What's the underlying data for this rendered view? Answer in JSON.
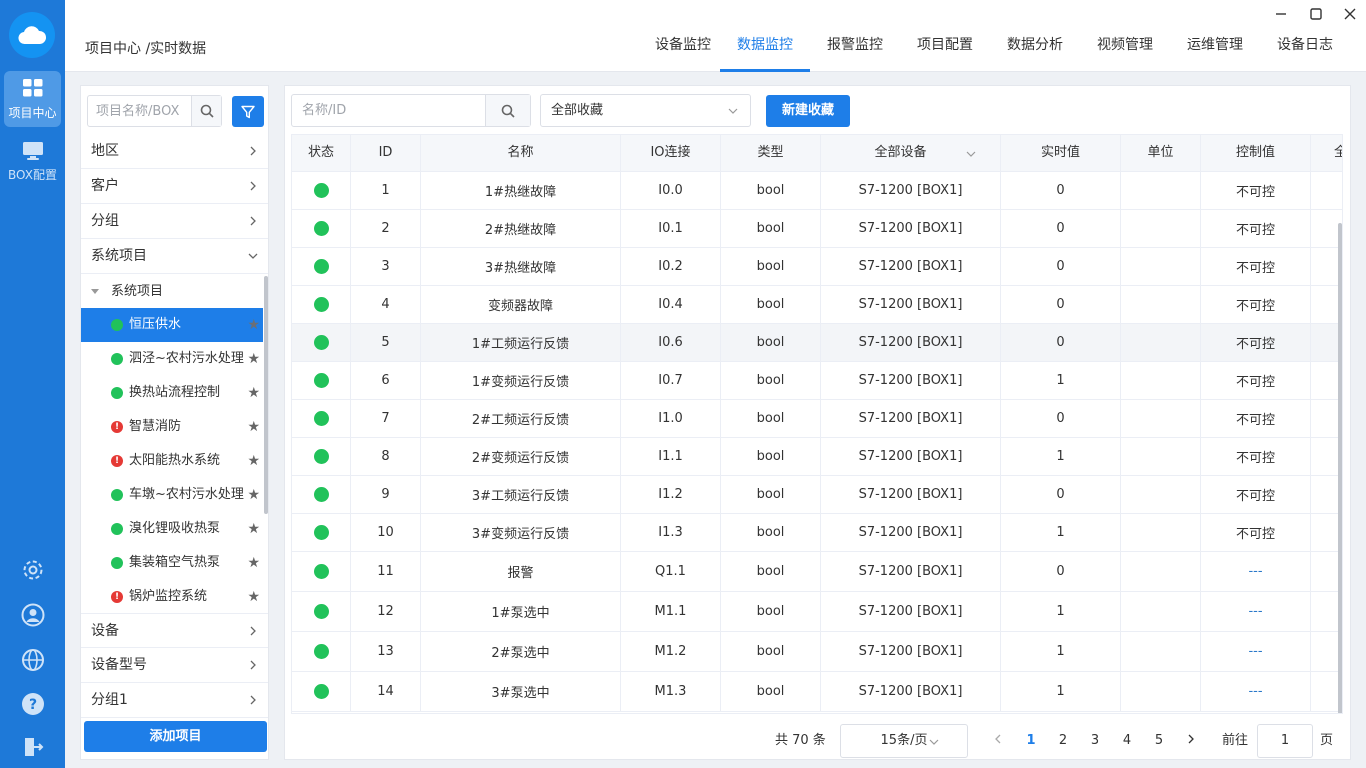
{
  "rail": {
    "items": [
      {
        "label": "项目中心",
        "icon": "grid-icon"
      },
      {
        "label": "BOX配置",
        "icon": "monitor-icon"
      }
    ],
    "bottom_icons": [
      "settings-gear-icon",
      "user-icon",
      "globe-icon",
      "help-icon",
      "logout-icon"
    ]
  },
  "header": {
    "breadcrumb": "项目中心 /实时数据",
    "tabs": [
      {
        "label": "设备监控"
      },
      {
        "label": "数据监控",
        "active": true
      },
      {
        "label": "报警监控"
      },
      {
        "label": "项目配置"
      },
      {
        "label": "数据分析"
      },
      {
        "label": "视频管理"
      },
      {
        "label": "运维管理"
      },
      {
        "label": "设备日志"
      }
    ]
  },
  "sidebar": {
    "search_placeholder": "项目名称/BOX",
    "categories_top": [
      {
        "label": "地区"
      },
      {
        "label": "客户"
      },
      {
        "label": "分组"
      },
      {
        "label": "系统项目"
      }
    ],
    "sub_header": "系统项目",
    "projects": [
      {
        "label": "恒压供水",
        "status": "ok",
        "active": true
      },
      {
        "label": "泗泾~农村污水处理",
        "status": "ok"
      },
      {
        "label": "换热站流程控制",
        "status": "ok"
      },
      {
        "label": "智慧消防",
        "status": "alarm"
      },
      {
        "label": "太阳能热水系统",
        "status": "alarm"
      },
      {
        "label": "车墩~农村污水处理",
        "status": "ok"
      },
      {
        "label": "溴化锂吸收热泵",
        "status": "ok"
      },
      {
        "label": "集装箱空气热泵",
        "status": "ok"
      },
      {
        "label": "锅炉监控系统",
        "status": "alarm"
      }
    ],
    "categories_bottom": [
      {
        "label": "设备"
      },
      {
        "label": "设备型号"
      },
      {
        "label": "分组1"
      }
    ],
    "add_label": "添加项目"
  },
  "toolbar": {
    "search_placeholder": "名称/ID",
    "favorites_selected": "全部收藏",
    "new_fav_label": "新建收藏"
  },
  "table": {
    "columns": [
      "状态",
      "ID",
      "名称",
      "IO连接",
      "类型",
      "全部设备",
      "实时值",
      "单位",
      "控制值",
      "全"
    ],
    "rows": [
      {
        "id": "1",
        "name": "1#热继故障",
        "io": "I0.0",
        "type": "bool",
        "device": "S7-1200 [BOX1]",
        "value": "0",
        "unit": "",
        "control": "不可控"
      },
      {
        "id": "2",
        "name": "2#热继故障",
        "io": "I0.1",
        "type": "bool",
        "device": "S7-1200 [BOX1]",
        "value": "0",
        "unit": "",
        "control": "不可控"
      },
      {
        "id": "3",
        "name": "3#热继故障",
        "io": "I0.2",
        "type": "bool",
        "device": "S7-1200 [BOX1]",
        "value": "0",
        "unit": "",
        "control": "不可控"
      },
      {
        "id": "4",
        "name": "变频器故障",
        "io": "I0.4",
        "type": "bool",
        "device": "S7-1200 [BOX1]",
        "value": "0",
        "unit": "",
        "control": "不可控"
      },
      {
        "id": "5",
        "name": "1#工频运行反馈",
        "io": "I0.6",
        "type": "bool",
        "device": "S7-1200 [BOX1]",
        "value": "0",
        "unit": "",
        "control": "不可控"
      },
      {
        "id": "6",
        "name": "1#变频运行反馈",
        "io": "I0.7",
        "type": "bool",
        "device": "S7-1200 [BOX1]",
        "value": "1",
        "unit": "",
        "control": "不可控"
      },
      {
        "id": "7",
        "name": "2#工频运行反馈",
        "io": "I1.0",
        "type": "bool",
        "device": "S7-1200 [BOX1]",
        "value": "0",
        "unit": "",
        "control": "不可控"
      },
      {
        "id": "8",
        "name": "2#变频运行反馈",
        "io": "I1.1",
        "type": "bool",
        "device": "S7-1200 [BOX1]",
        "value": "1",
        "unit": "",
        "control": "不可控"
      },
      {
        "id": "9",
        "name": "3#工频运行反馈",
        "io": "I1.2",
        "type": "bool",
        "device": "S7-1200 [BOX1]",
        "value": "0",
        "unit": "",
        "control": "不可控"
      },
      {
        "id": "10",
        "name": "3#变频运行反馈",
        "io": "I1.3",
        "type": "bool",
        "device": "S7-1200 [BOX1]",
        "value": "1",
        "unit": "",
        "control": "不可控"
      },
      {
        "id": "11",
        "name": "报警",
        "io": "Q1.1",
        "type": "bool",
        "device": "S7-1200 [BOX1]",
        "value": "0",
        "unit": "",
        "control": "---"
      },
      {
        "id": "12",
        "name": "1#泵选中",
        "io": "M1.1",
        "type": "bool",
        "device": "S7-1200 [BOX1]",
        "value": "1",
        "unit": "",
        "control": "---"
      },
      {
        "id": "13",
        "name": "2#泵选中",
        "io": "M1.2",
        "type": "bool",
        "device": "S7-1200 [BOX1]",
        "value": "1",
        "unit": "",
        "control": "---"
      },
      {
        "id": "14",
        "name": "3#泵选中",
        "io": "M1.3",
        "type": "bool",
        "device": "S7-1200 [BOX1]",
        "value": "1",
        "unit": "",
        "control": "---"
      }
    ]
  },
  "pagination": {
    "total": "共 70 条",
    "page_size": "15条/页",
    "pages": [
      "1",
      "2",
      "3",
      "4",
      "5"
    ],
    "current": "1",
    "goto_label": "前往",
    "goto_value": "1",
    "page_suffix": "页"
  },
  "colors": {
    "accent": "#1e7ee8",
    "rail": "#1e79d8",
    "ok": "#21c25a",
    "alarm": "#e53935"
  }
}
